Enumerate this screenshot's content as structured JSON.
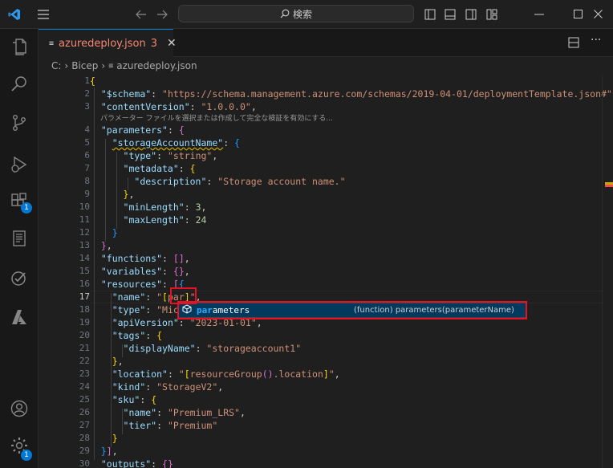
{
  "titlebar": {
    "search_placeholder": "検索"
  },
  "tab": {
    "label": "azuredeploy.json",
    "problems": "3"
  },
  "breadcrumb": {
    "drive": "C:",
    "folder": "Bicep",
    "file": "azuredeploy.json"
  },
  "badges": {
    "extensions": "1",
    "settings": "1"
  },
  "hint_text": "パラメーター ファイルを選択または作成して完全な検証を有効にする...",
  "line_numbers": [
    "1",
    "2",
    "3",
    "4",
    "5",
    "6",
    "7",
    "8",
    "9",
    "10",
    "11",
    "12",
    "13",
    "14",
    "15",
    "16",
    "17",
    "18",
    "19",
    "20",
    "21",
    "22",
    "23",
    "24",
    "25",
    "26",
    "27",
    "28",
    "29",
    "30"
  ],
  "code": {
    "l2": {
      "key": "\"$schema\"",
      "val": "\"https://schema.management.azure.com/schemas/2019-04-01/deploymentTemplate.json#\""
    },
    "l3": {
      "key": "\"contentVersion\"",
      "val": "\"1.0.0.0\""
    },
    "l4": {
      "key": "\"parameters\""
    },
    "l5": {
      "key": "\"storageAccountName\""
    },
    "l6": {
      "key": "\"type\"",
      "val": "\"string\""
    },
    "l7": {
      "key": "\"metadata\""
    },
    "l8": {
      "key": "\"description\"",
      "val": "\"Storage account name.\""
    },
    "l10": {
      "key": "\"minLength\"",
      "val": "3"
    },
    "l11": {
      "key": "\"maxLength\"",
      "val": "24"
    },
    "l14": {
      "key": "\"functions\""
    },
    "l15": {
      "key": "\"variables\""
    },
    "l16": {
      "key": "\"resources\""
    },
    "l17": {
      "key": "\"name\"",
      "val_open": "\"",
      "val_text": "par",
      "val_close": "\""
    },
    "l18": {
      "key": "\"type\"",
      "val": "\"Micr"
    },
    "l19": {
      "key": "\"apiVersion\"",
      "val": "\"2023-01-01\""
    },
    "l20": {
      "key": "\"tags\""
    },
    "l21": {
      "key": "\"displayName\"",
      "val": "\"storageaccount1\""
    },
    "l23": {
      "key": "\"location\"",
      "val_a": "\"",
      "val_fn": "resourceGroup",
      "val_prop": ".location",
      "val_z": "\""
    },
    "l24": {
      "key": "\"kind\"",
      "val": "\"StorageV2\""
    },
    "l25": {
      "key": "\"sku\""
    },
    "l26": {
      "key": "\"name\"",
      "val": "\"Premium_LRS\""
    },
    "l27": {
      "key": "\"tier\"",
      "val": "\"Premium\""
    },
    "l30": {
      "key": "\"outputs\""
    }
  },
  "suggestion": {
    "match": "par",
    "rest": "ameters",
    "detail": "(function) parameters(parameterName)"
  }
}
